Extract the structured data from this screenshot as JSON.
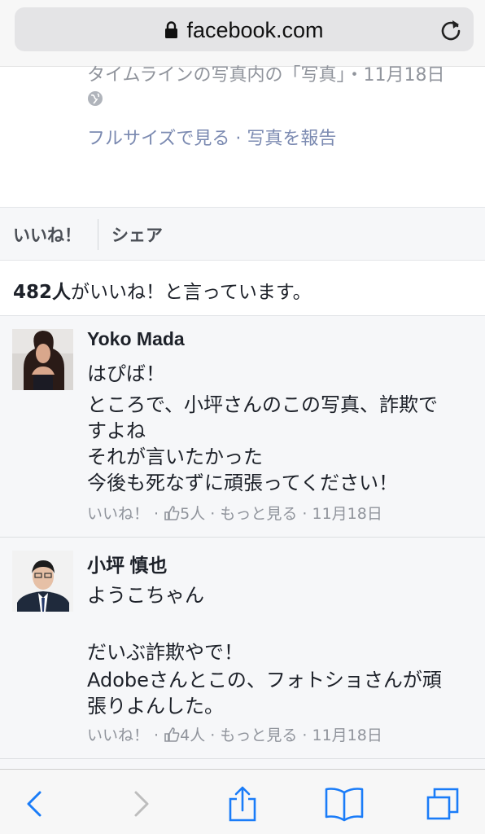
{
  "browser": {
    "url": "facebook.com",
    "icons": {
      "lock": "lock-icon",
      "reload": "reload-icon"
    }
  },
  "photo_info": {
    "cut_text": "タイムラインの写真内の「写真」・11月18日",
    "links": "フルサイズで見る · 写真を報告"
  },
  "actions": {
    "like": "いいね！",
    "share": "シェア"
  },
  "likes": {
    "count": "482人",
    "suffix": "がいいね！と言っています。"
  },
  "comments": [
    {
      "name": "Yoko Mada",
      "lines": [
        "はぴば！",
        "ところで、小坪さんのこの写真、詐欺で",
        "すよね",
        "それが言いたかった",
        "今後も死なずに頑張ってください！"
      ],
      "meta": {
        "like": "いいね！",
        "sep1": " · ",
        "likes": "5人",
        "sep2": " · ",
        "more": "もっと見る",
        "sep3": " · ",
        "date": "11月18日"
      }
    },
    {
      "name": "小坪 慎也",
      "lines": [
        "ようこちゃん",
        "だいぶ詐欺やで！",
        "Adobeさんとこの、フォトショさんが頑",
        "張りよんした。"
      ],
      "meta": {
        "like": "いいね！",
        "sep1": " · ",
        "likes": "4人",
        "sep2": " · ",
        "more": "もっと見る",
        "sep3": " · ",
        "date": "11月18日"
      }
    }
  ],
  "toolbar": {
    "icons": [
      "back-icon",
      "forward-icon",
      "share-icon",
      "bookmarks-icon",
      "tabs-icon"
    ],
    "colors": {
      "accent": "#1a7cf8",
      "disabled": "#bdbdbd"
    }
  }
}
